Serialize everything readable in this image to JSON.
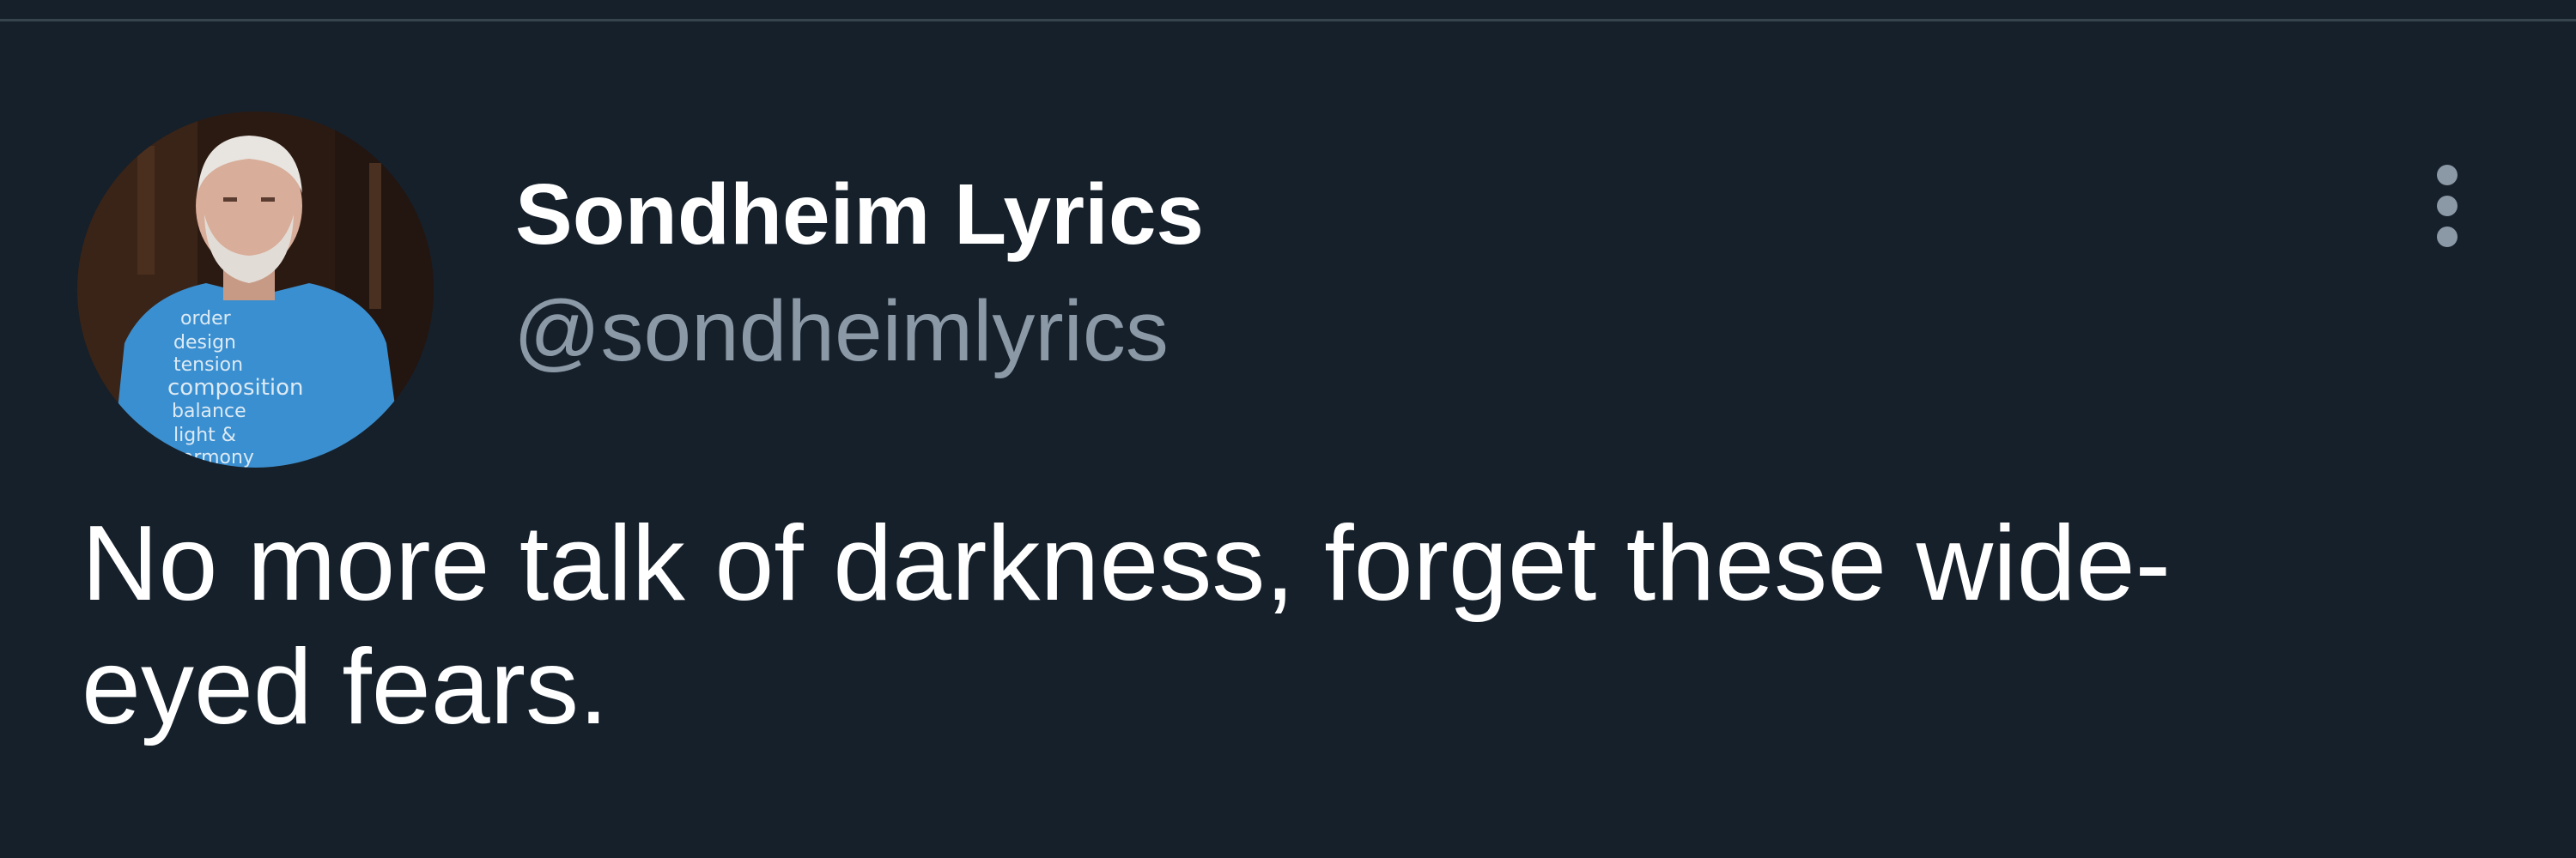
{
  "tweet": {
    "author": {
      "display_name": "Sondheim Lyrics",
      "handle": "@sondheimlyrics",
      "avatar_shirt_text": [
        "order",
        "design",
        "tension",
        "composition",
        "balance",
        "light &",
        "harmony"
      ]
    },
    "text": "No more talk of darkness, forget these wide-eyed fears.",
    "more_icon": "more-vertical-icon"
  },
  "colors": {
    "background": "#15202b",
    "primary_text": "#ffffff",
    "secondary_text": "#8b98a5",
    "divider": "#38444d",
    "shirt": "#3a8fd0"
  }
}
